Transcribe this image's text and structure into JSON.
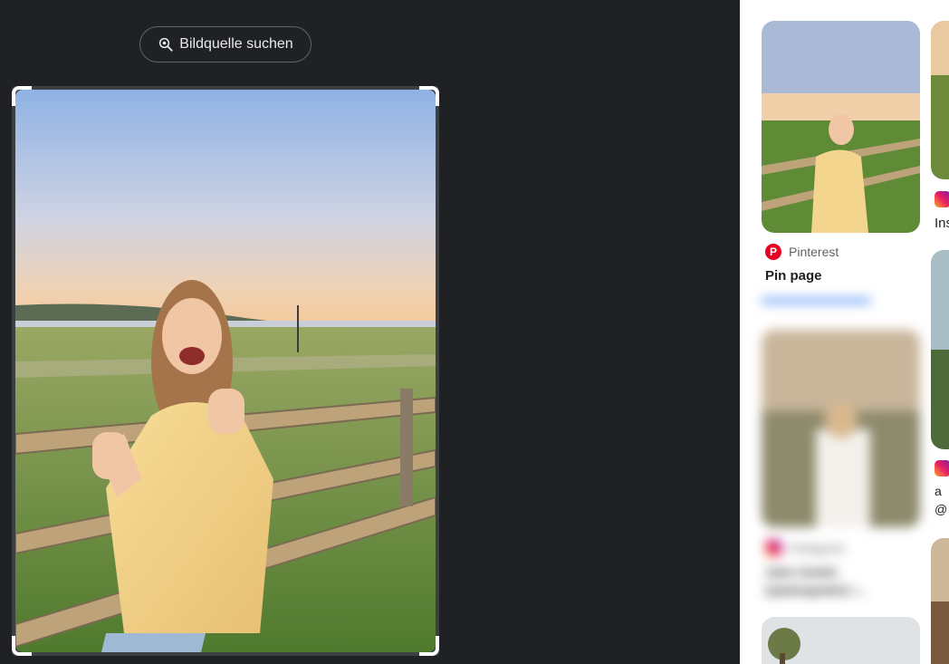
{
  "search_source": {
    "label": "Bildquelle suchen"
  },
  "results": [
    {
      "source": "Pinterest",
      "title": "Pin page",
      "icon": "pinterest-icon"
    },
    {
      "source": "Ins",
      "icon": "instagram-icon"
    },
    {
      "source": "Instagram",
      "title": "Jules Gaskin",
      "subtitle": "(@julesgaskin) •...",
      "icon": "instagram-icon"
    },
    {
      "source": "a",
      "subtitle": "@",
      "icon": "instagram-icon"
    }
  ],
  "colors": {
    "bg_dark": "#202124",
    "accent": "#1a73e8",
    "pinterest": "#e60023"
  }
}
